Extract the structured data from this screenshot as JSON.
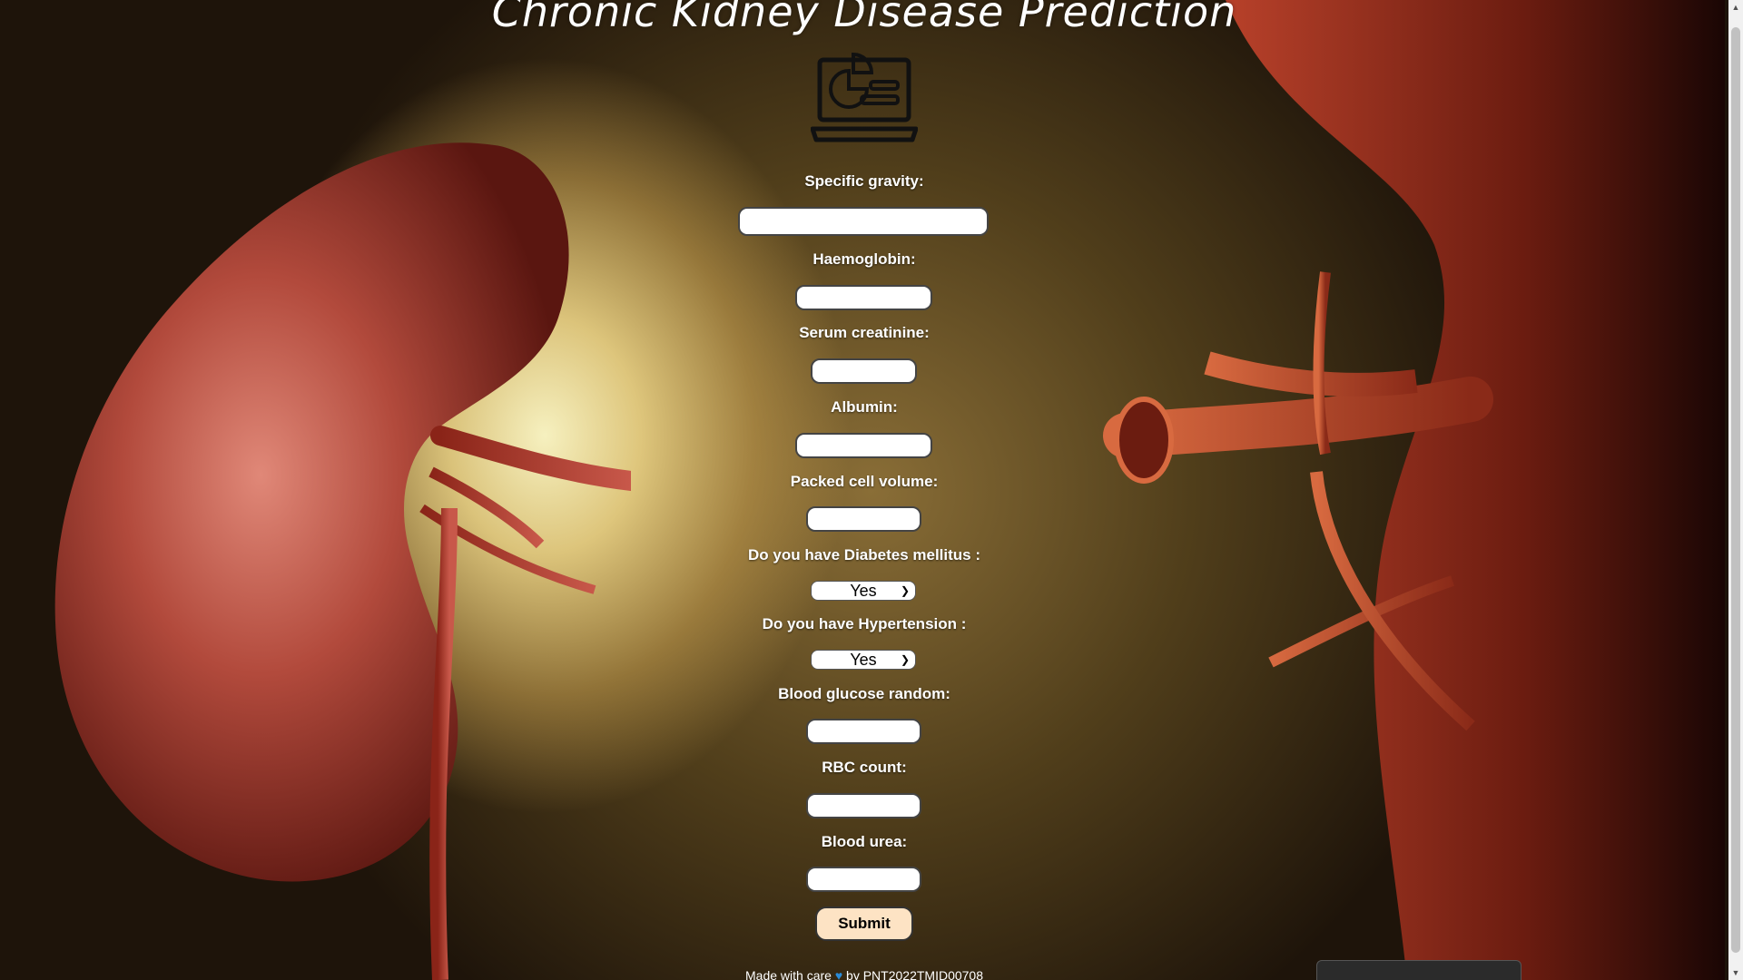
{
  "header": {
    "title": "Chronic Kidney Disease Prediction",
    "logo_icon": "laptop-chart-icon"
  },
  "form": {
    "fields": [
      {
        "label": "Specific gravity:",
        "value": ""
      },
      {
        "label": "Haemoglobin:",
        "value": ""
      },
      {
        "label": "Serum creatinine:",
        "value": ""
      },
      {
        "label": "Albumin:",
        "value": ""
      },
      {
        "label": "Packed cell volume:",
        "value": ""
      }
    ],
    "diabetes": {
      "label": "Do you have Diabetes mellitus :",
      "selected": "Yes"
    },
    "hypertension": {
      "label": "Do you have Hypertension :",
      "selected": "Yes"
    },
    "fields2": [
      {
        "label": "Blood glucose random:",
        "value": ""
      },
      {
        "label": "RBC count:",
        "value": ""
      },
      {
        "label": "Blood urea:",
        "value": ""
      }
    ],
    "submit_label": "Submit"
  },
  "footer": {
    "prefix": "Made with care",
    "heart": "♥",
    "suffix": "by PNT2022TMID00708"
  },
  "colors": {
    "submit_bg": "#fde3c4",
    "heart": "#2a8bd8",
    "label_text": "#ffffff"
  }
}
